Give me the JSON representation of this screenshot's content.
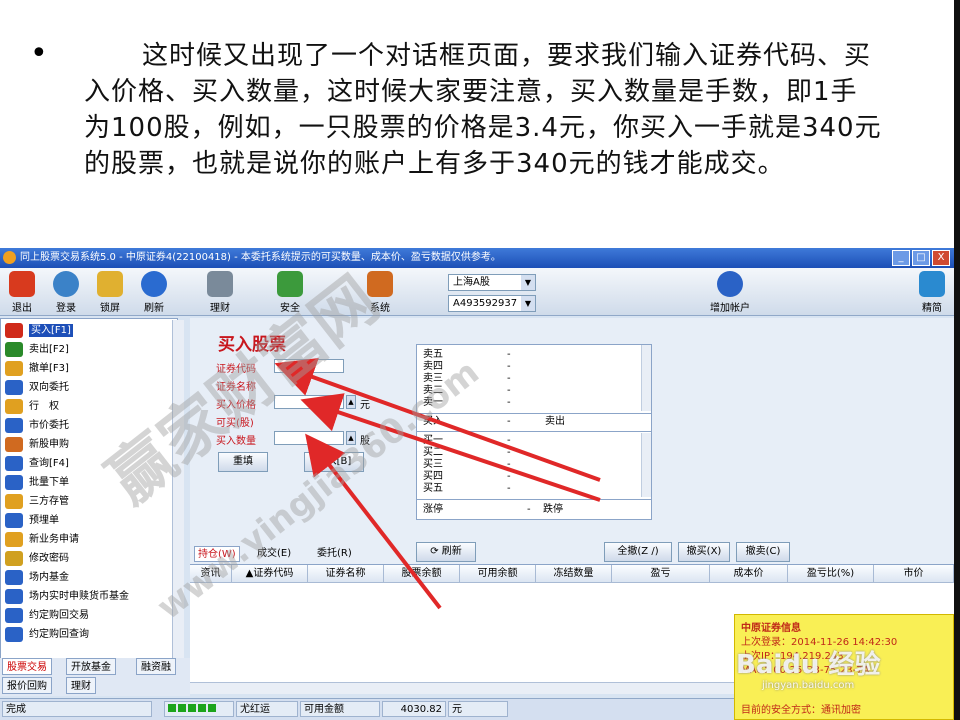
{
  "slide": {
    "bullet": "•",
    "paragraph": "这时候又出现了一个对话框页面，要求我们输入证券代码、买入价格、买入数量，这时候大家要注意，买入数量是手数，即1手为100股，例如，一只股票的价格是3.4元，你买入一手就是340元的股票，也就是说你的账户上有多于340元的钱才能成交。"
  },
  "window": {
    "title": "同上股票交易系统5.0 - 中原证券4(22100418) - 本委托系统提示的可买数量、成本价、盈亏数据仅供参考。",
    "buttons": [
      "_",
      "□",
      "X"
    ]
  },
  "toolbar": {
    "items": [
      {
        "label": "退出",
        "icon": "power-icon",
        "color": "#d83a1e"
      },
      {
        "label": "登录",
        "icon": "users-icon",
        "color": "#3b82c8"
      },
      {
        "label": "锁屏",
        "icon": "lock-screen-icon",
        "color": "#e0b030"
      },
      {
        "label": "刷新",
        "icon": "refresh-icon",
        "color": "#2a6bd0"
      },
      {
        "label": "理财",
        "icon": "finance-icon",
        "color": "#7a8a9a"
      },
      {
        "label": "安全",
        "icon": "shield-icon",
        "color": "#3c9a3c"
      },
      {
        "label": "系统",
        "icon": "tools-icon",
        "color": "#d06a20"
      },
      {
        "label": "增加帐户",
        "icon": "add-account-icon",
        "color": "#2a62c6"
      },
      {
        "label": "精简",
        "icon": "compact-icon",
        "color": "#2a8ad0"
      }
    ],
    "market_select": "上海A股",
    "account_select": "A493592937"
  },
  "nav": {
    "items": [
      {
        "label": "买入[F1]",
        "icon": "buy-icon",
        "color": "#d02a1a",
        "active": true
      },
      {
        "label": "卖出[F2]",
        "icon": "sell-icon",
        "color": "#2a8a2a"
      },
      {
        "label": "撤单[F3]",
        "icon": "cancel-order-icon",
        "color": "#e0a020"
      },
      {
        "label": "双向委托",
        "icon": "two-way-icon",
        "color": "#2a62c6"
      },
      {
        "label": "行　权",
        "icon": "exercise-icon",
        "color": "#e0a020"
      },
      {
        "label": "市价委托",
        "icon": "market-order-icon",
        "color": "#2a62c6"
      },
      {
        "label": "新股申购",
        "icon": "ipo-icon",
        "color": "#d06a20"
      },
      {
        "label": "查询[F4]",
        "icon": "query-icon",
        "color": "#2a62c6"
      },
      {
        "label": "批量下单",
        "icon": "batch-icon",
        "color": "#2a62c6"
      },
      {
        "label": "三方存管",
        "icon": "custody-icon",
        "color": "#e0a020"
      },
      {
        "label": "预埋单",
        "icon": "preset-icon",
        "color": "#2a62c6"
      },
      {
        "label": "新业务申请",
        "icon": "apply-icon",
        "color": "#e0a020"
      },
      {
        "label": "修改密码",
        "icon": "key-icon",
        "color": "#d0a020"
      },
      {
        "label": "场内基金",
        "icon": "fund-icon",
        "color": "#2a62c6"
      },
      {
        "label": "场内实时申赎货币基金",
        "icon": "money-fund-icon",
        "color": "#2a62c6"
      },
      {
        "label": "约定购回交易",
        "icon": "repo-icon",
        "color": "#2a62c6"
      },
      {
        "label": "约定购回查询",
        "icon": "repo-query-icon",
        "color": "#2a62c6"
      }
    ],
    "tabs_row1": [
      "股票交易",
      "开放基金",
      "融资融"
    ],
    "tabs_row2": [
      "报价回购",
      "理财"
    ]
  },
  "order_form": {
    "title": "买入股票",
    "labels": [
      "证券代码",
      "证券名称",
      "买入价格",
      "可买(股)",
      "买入数量"
    ],
    "unit": "元",
    "unit2": "股",
    "reset_button": "重填",
    "buy_button": "买入[B]"
  },
  "quote": {
    "sell_rows": [
      "卖五",
      "卖四",
      "卖三",
      "卖二",
      "卖一"
    ],
    "buy_rows": [
      "买一",
      "买二",
      "买三",
      "买四",
      "买五"
    ],
    "placeholder": "-",
    "mid_buy": "买入",
    "mid_sell": "卖出",
    "limit_up": "涨停",
    "limit_down": "跌停"
  },
  "positions": {
    "tabs": [
      "持仓(W)",
      "成交(E)",
      "委托(R)"
    ],
    "refresh_button": "刷新",
    "actions": [
      "全撤(Z /)",
      "撤买(X)",
      "撤卖(C)"
    ],
    "columns": [
      "资讯",
      "▲证券代码",
      "证券名称",
      "股票余额",
      "可用余额",
      "冻结数量",
      "盈亏",
      "成本价",
      "盈亏比(%)",
      "市价"
    ]
  },
  "status": {
    "left": "完成",
    "user": "尤红运",
    "avail_label": "可用金额",
    "avail_value": "4030.82",
    "unit": "元"
  },
  "popup": {
    "lines": [
      "中原证券信息",
      "上次登录：2014-11-26 14:42:30",
      "上次IP：194.219.243",
      "MAC：00-25-D3-75-23-7A",
      "目前的安全方式：通讯加密"
    ]
  },
  "watermarks": {
    "main": "赢家财富网",
    "url": "www.yingjia360.com",
    "baidu": "Baidu 经验",
    "baidu_url": "jingyan.baidu.com"
  },
  "colors": {
    "accent_red": "#c8161d",
    "title_blue": "#1c4fb6",
    "popup_yellow": "#f9ef55"
  }
}
